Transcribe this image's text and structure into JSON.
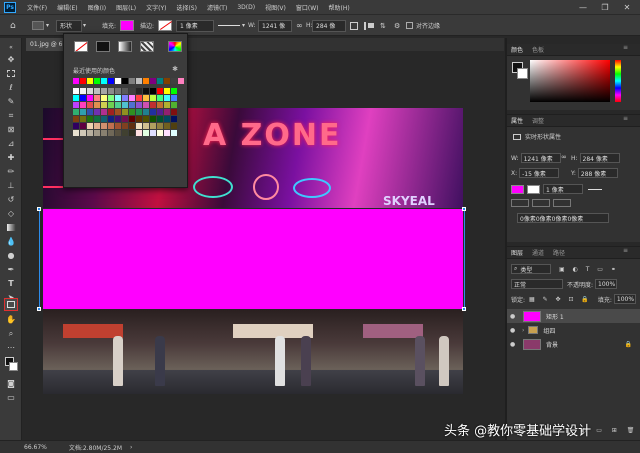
{
  "menubar": {
    "logo": "Ps",
    "items": [
      "文件(F)",
      "编辑(E)",
      "图像(I)",
      "图层(L)",
      "文字(Y)",
      "选择(S)",
      "滤镜(T)",
      "3D(D)",
      "视图(V)",
      "窗口(W)",
      "帮助(H)"
    ],
    "minimize": "—",
    "maximize": "❐",
    "close": "✕"
  },
  "options": {
    "home": "⌂",
    "mode_value": "形状",
    "fill_label": "填充:",
    "fill_color": "#ff00ff",
    "stroke_label": "描边:",
    "stroke_width": "1 像素",
    "w_label": "W:",
    "w_value": "1241 像",
    "link": "∞",
    "h_label": "H:",
    "h_value": "284 像",
    "align_label": "对齐边缘"
  },
  "document": {
    "tab_label": "01.jpg @ 66"
  },
  "canvas": {
    "neon_text": "A ZONE",
    "neon_sign2": "SKYEAL",
    "shape_color": "#ff00ff"
  },
  "popup": {
    "recent_label": "最近使用的颜色",
    "gear": "✱",
    "recent_colors": [
      "#ff00ff",
      "#ff0000",
      "#ffff00",
      "#00ff00",
      "#00ffff",
      "#0000ff",
      "#ffffff",
      "#000000",
      "#808080",
      "#c0c0c0",
      "#ff8000",
      "#800080",
      "#008080",
      "#804000",
      "#404040",
      "#ff80c0"
    ],
    "swatches": [
      "#ffffff",
      "#f2f2f2",
      "#d9d9d9",
      "#bfbfbf",
      "#a6a6a6",
      "#8c8c8c",
      "#737373",
      "#595959",
      "#404040",
      "#262626",
      "#0d0d0d",
      "#000000",
      "#ff0000",
      "#ffff00",
      "#00ff00",
      "#00ffff",
      "#0000ff",
      "#ff00ff",
      "#ff8080",
      "#ffff80",
      "#80ff80",
      "#80ffff",
      "#8080ff",
      "#ff80ff",
      "#ff4040",
      "#ffbf40",
      "#bfff40",
      "#40ff80",
      "#40ffff",
      "#4080ff",
      "#bf40ff",
      "#ff40bf",
      "#e05050",
      "#e09050",
      "#d0d050",
      "#70d050",
      "#50d090",
      "#50c0d0",
      "#5070d0",
      "#9050d0",
      "#d050b0",
      "#c03030",
      "#c07030",
      "#b0b030",
      "#50b030",
      "#30b070",
      "#30a0b0",
      "#3050b0",
      "#7030b0",
      "#b03090",
      "#a02020",
      "#a05020",
      "#909020",
      "#309020",
      "#209050",
      "#208090",
      "#2030a0",
      "#502090",
      "#902070",
      "#801010",
      "#804010",
      "#707010",
      "#207010",
      "#107040",
      "#106070",
      "#102080",
      "#401070",
      "#701050",
      "#600000",
      "#603000",
      "#505000",
      "#105000",
      "#005030",
      "#004860",
      "#001060",
      "#300060",
      "#600040",
      "#f0d0b0",
      "#e0b090",
      "#d09070",
      "#c07050",
      "#a05030",
      "#804020",
      "#603010",
      "#f0e0c0",
      "#d0c090",
      "#b0a060",
      "#908040",
      "#706020",
      "#504010",
      "#e8e0d0",
      "#d0c8b8",
      "#b8b0a0",
      "#a09888",
      "#888070",
      "#706858",
      "#585040",
      "#404030",
      "#303020",
      "#ffe0e0",
      "#e0ffe0",
      "#e0e0ff",
      "#ffffe0",
      "#ffe0ff",
      "#e0ffff"
    ]
  },
  "color_panel": {
    "tabs": [
      "颜色",
      "色板"
    ]
  },
  "properties": {
    "tabs": [
      "属性",
      "调整"
    ],
    "title": "实时形状属性",
    "w_label": "W:",
    "w_value": "1241 像素",
    "h_label": "H:",
    "h_value": "284 像素",
    "x_label": "X:",
    "x_value": "-15 像素",
    "y_label": "Y:",
    "y_value": "288 像素",
    "stroke_width": "1 像素",
    "corners": "0像素0像素0像素0像素",
    "fill_color": "#ff00ff"
  },
  "layers": {
    "tabs": [
      "图层",
      "通道",
      "路径"
    ],
    "kind_label": "类型",
    "blend_mode": "正常",
    "opacity_label": "不透明度:",
    "opacity_value": "100%",
    "lock_label": "锁定:",
    "fill_label": "填充:",
    "fill_value": "100%",
    "rows": [
      {
        "name": "矩形 1",
        "eye": "●",
        "thumb_color": "#ff00ff"
      },
      {
        "name": "组四",
        "eye": "●",
        "thumb_color": "#c8a050"
      },
      {
        "name": "背景",
        "eye": "●",
        "thumb_color": "#8a3a6a"
      }
    ],
    "lock_icon": "🔒",
    "footer_icons": "⚭ fx ◧ ◐ ▭ ⊞ 🗑"
  },
  "status": {
    "zoom": "66.67%",
    "doc_info": "文档:2.80M/25.2M",
    "arrow": "›"
  },
  "watermark": "头条 @教你零基础学设计"
}
